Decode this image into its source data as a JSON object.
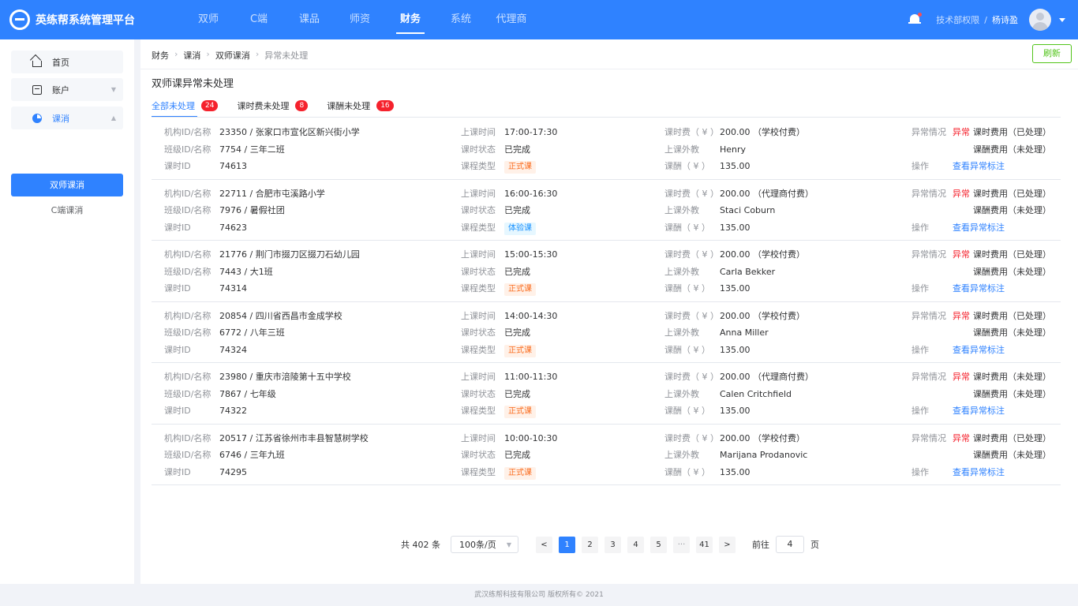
{
  "brand": {
    "name": "英练帮系统管理平台"
  },
  "nav": {
    "items": [
      "双师",
      "C端",
      "课品",
      "师资",
      "财务",
      "系统",
      "代理商"
    ],
    "active": "财务"
  },
  "user": {
    "permission": "技术部权限",
    "separator": "/",
    "name": "杨诗盈"
  },
  "sidebar": {
    "items": [
      {
        "label": "首页",
        "icon": "home-icon"
      },
      {
        "label": "账户",
        "icon": "account-icon"
      },
      {
        "label": "课消",
        "icon": "pie-chart-icon"
      }
    ],
    "sub_active": "双师课消",
    "sub_other": "C端课消"
  },
  "breadcrumb": [
    "财务",
    "课消",
    "双师课消",
    "异常未处理"
  ],
  "refresh_label": "刷新",
  "page_title": "双师课异常未处理",
  "tabs": [
    {
      "label": "全部未处理",
      "count": "24"
    },
    {
      "label": "课时费未处理",
      "count": "8"
    },
    {
      "label": "课酬未处理",
      "count": "16"
    }
  ],
  "labels": {
    "org": "机构ID/名称",
    "class": "班级ID/名称",
    "lesson_id": "课时ID",
    "time": "上课时间",
    "status": "课时状态",
    "type": "课程类型",
    "fee": "课时费（ ¥ ）",
    "teacher": "上课外教",
    "pay": "课酬（ ¥ ）",
    "abnormal": "异常情况",
    "op": "操作",
    "abn_word": "异常",
    "link": "查看异常标注"
  },
  "records": [
    {
      "org": "23350 / 张家口市宣化区新兴街小学",
      "class": "7754 / 三年二班",
      "lesson_id": "74613",
      "time": "17:00-17:30",
      "status": "已完成",
      "type": "正式课",
      "fee": "200.00 （学校付费）",
      "teacher": "Henry",
      "pay": "135.00",
      "fee_state": "课时费用（已处理）",
      "pay_state": "课酬费用（未处理）"
    },
    {
      "org": "22711 / 合肥市屯溪路小学",
      "class": "7976 / 暑假社团",
      "lesson_id": "74623",
      "time": "16:00-16:30",
      "status": "已完成",
      "type": "体验课",
      "fee": "200.00 （代理商付费）",
      "teacher": "Staci Coburn",
      "pay": "135.00",
      "fee_state": "课时费用（已处理）",
      "pay_state": "课酬费用（未处理）"
    },
    {
      "org": "21776 / 荆门市掇刀区掇刀石幼儿园",
      "class": "7443 / 大1班",
      "lesson_id": "74314",
      "time": "15:00-15:30",
      "status": "已完成",
      "type": "正式课",
      "fee": "200.00 （学校付费）",
      "teacher": "Carla Bekker",
      "pay": "135.00",
      "fee_state": "课时费用（已处理）",
      "pay_state": "课酬费用（未处理）"
    },
    {
      "org": "20854 / 四川省西昌市金成学校",
      "class": "6772 / 八年三班",
      "lesson_id": "74324",
      "time": "14:00-14:30",
      "status": "已完成",
      "type": "正式课",
      "fee": "200.00 （学校付费）",
      "teacher": "Anna Miller",
      "pay": "135.00",
      "fee_state": "课时费用（已处理）",
      "pay_state": "课酬费用（未处理）"
    },
    {
      "org": "23980 / 重庆市涪陵第十五中学校",
      "class": "7867 / 七年级",
      "lesson_id": "74322",
      "time": "11:00-11:30",
      "status": "已完成",
      "type": "正式课",
      "fee": "200.00 （代理商付费）",
      "teacher": "Calen Critchfield",
      "pay": "135.00",
      "fee_state": "课时费用（未处理）",
      "pay_state": "课酬费用（未处理）"
    },
    {
      "org": "20517 / 江苏省徐州市丰县智慧树学校",
      "class": "6746 / 三年九班",
      "lesson_id": "74295",
      "time": "10:00-10:30",
      "status": "已完成",
      "type": "正式课",
      "fee": "200.00 （学校付费）",
      "teacher": "Marijana Prodanovic",
      "pay": "135.00",
      "fee_state": "课时费用（已处理）",
      "pay_state": "课酬费用（未处理）"
    }
  ],
  "pagination": {
    "total_text": "共 402 条",
    "page_size": "100条/页",
    "prev": "<",
    "next": ">",
    "pages": [
      "1",
      "2",
      "3",
      "4",
      "5",
      "···",
      "41"
    ],
    "current": "1",
    "goto_label": "前往",
    "goto_value": "4",
    "goto_unit": "页"
  },
  "footer": "武汉练帮科技有限公司 版权所有© 2021",
  "colors": {
    "primary": "#2f82ff",
    "danger": "#f5222d",
    "success": "#52c41a",
    "formal_tag": "#fa6c1e",
    "trial_tag": "#1890ff"
  }
}
